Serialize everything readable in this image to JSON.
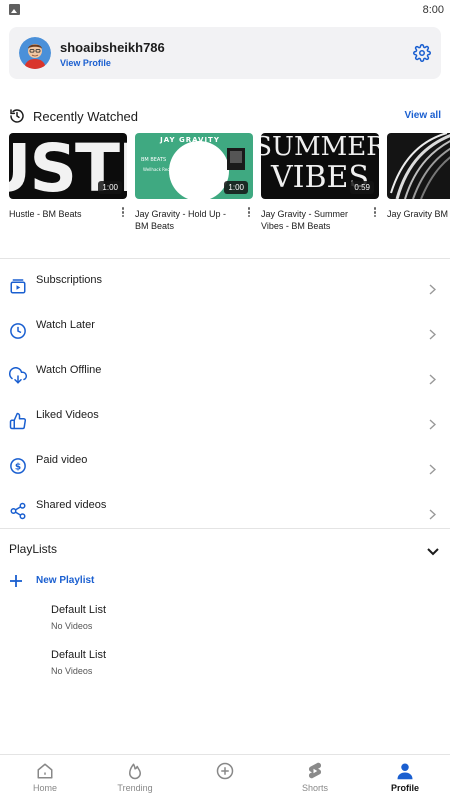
{
  "status_bar": {
    "time": "8:00"
  },
  "profile": {
    "username": "shoaibsheikh786",
    "view_profile_label": "View Profile"
  },
  "recently_watched": {
    "title": "Recently Watched",
    "view_all_label": "View all",
    "items": [
      {
        "title": "Hustle - BM Beats",
        "duration": "1:00",
        "thumb_text": "USTL"
      },
      {
        "title": "Jay Gravity - Hold Up - BM Beats",
        "duration": "1:00",
        "thumb_text": "JAY GRAVITY",
        "thumb_sub": "BM BEATS",
        "thumb_sub2": "Wellhack Records"
      },
      {
        "title": "Jay Gravity - Summer Vibes - BM Beats",
        "duration": "0:59",
        "thumb_text": "SUMMER",
        "thumb_text2": "VIBES"
      },
      {
        "title": "Jay Gravity BM Beats",
        "duration": ""
      }
    ]
  },
  "menu": [
    {
      "label": "Subscriptions",
      "icon": "subscriptions-icon"
    },
    {
      "label": "Watch Later",
      "icon": "clock-icon"
    },
    {
      "label": "Watch Offline",
      "icon": "download-cloud-icon"
    },
    {
      "label": "Liked Videos",
      "icon": "thumbs-up-icon"
    },
    {
      "label": "Paid video",
      "icon": "dollar-icon"
    },
    {
      "label": "Shared videos",
      "icon": "share-icon"
    }
  ],
  "playlists": {
    "title": "PlayLists",
    "new_playlist_label": "New Playlist",
    "items": [
      {
        "name": "Default List",
        "count": "No Videos"
      },
      {
        "name": "Default List",
        "count": "No Videos"
      }
    ]
  },
  "bottom_nav": [
    {
      "label": "Home",
      "icon": "home-icon",
      "active": false
    },
    {
      "label": "Trending",
      "icon": "flame-icon",
      "active": false
    },
    {
      "label": "",
      "icon": "add-circle-icon",
      "active": false
    },
    {
      "label": "Shorts",
      "icon": "shorts-icon",
      "active": false
    },
    {
      "label": "Profile",
      "icon": "person-icon",
      "active": true
    }
  ],
  "colors": {
    "accent": "#1a5fd0",
    "card_bg": "#f2f2f4",
    "thumb_green": "#3fa981"
  }
}
